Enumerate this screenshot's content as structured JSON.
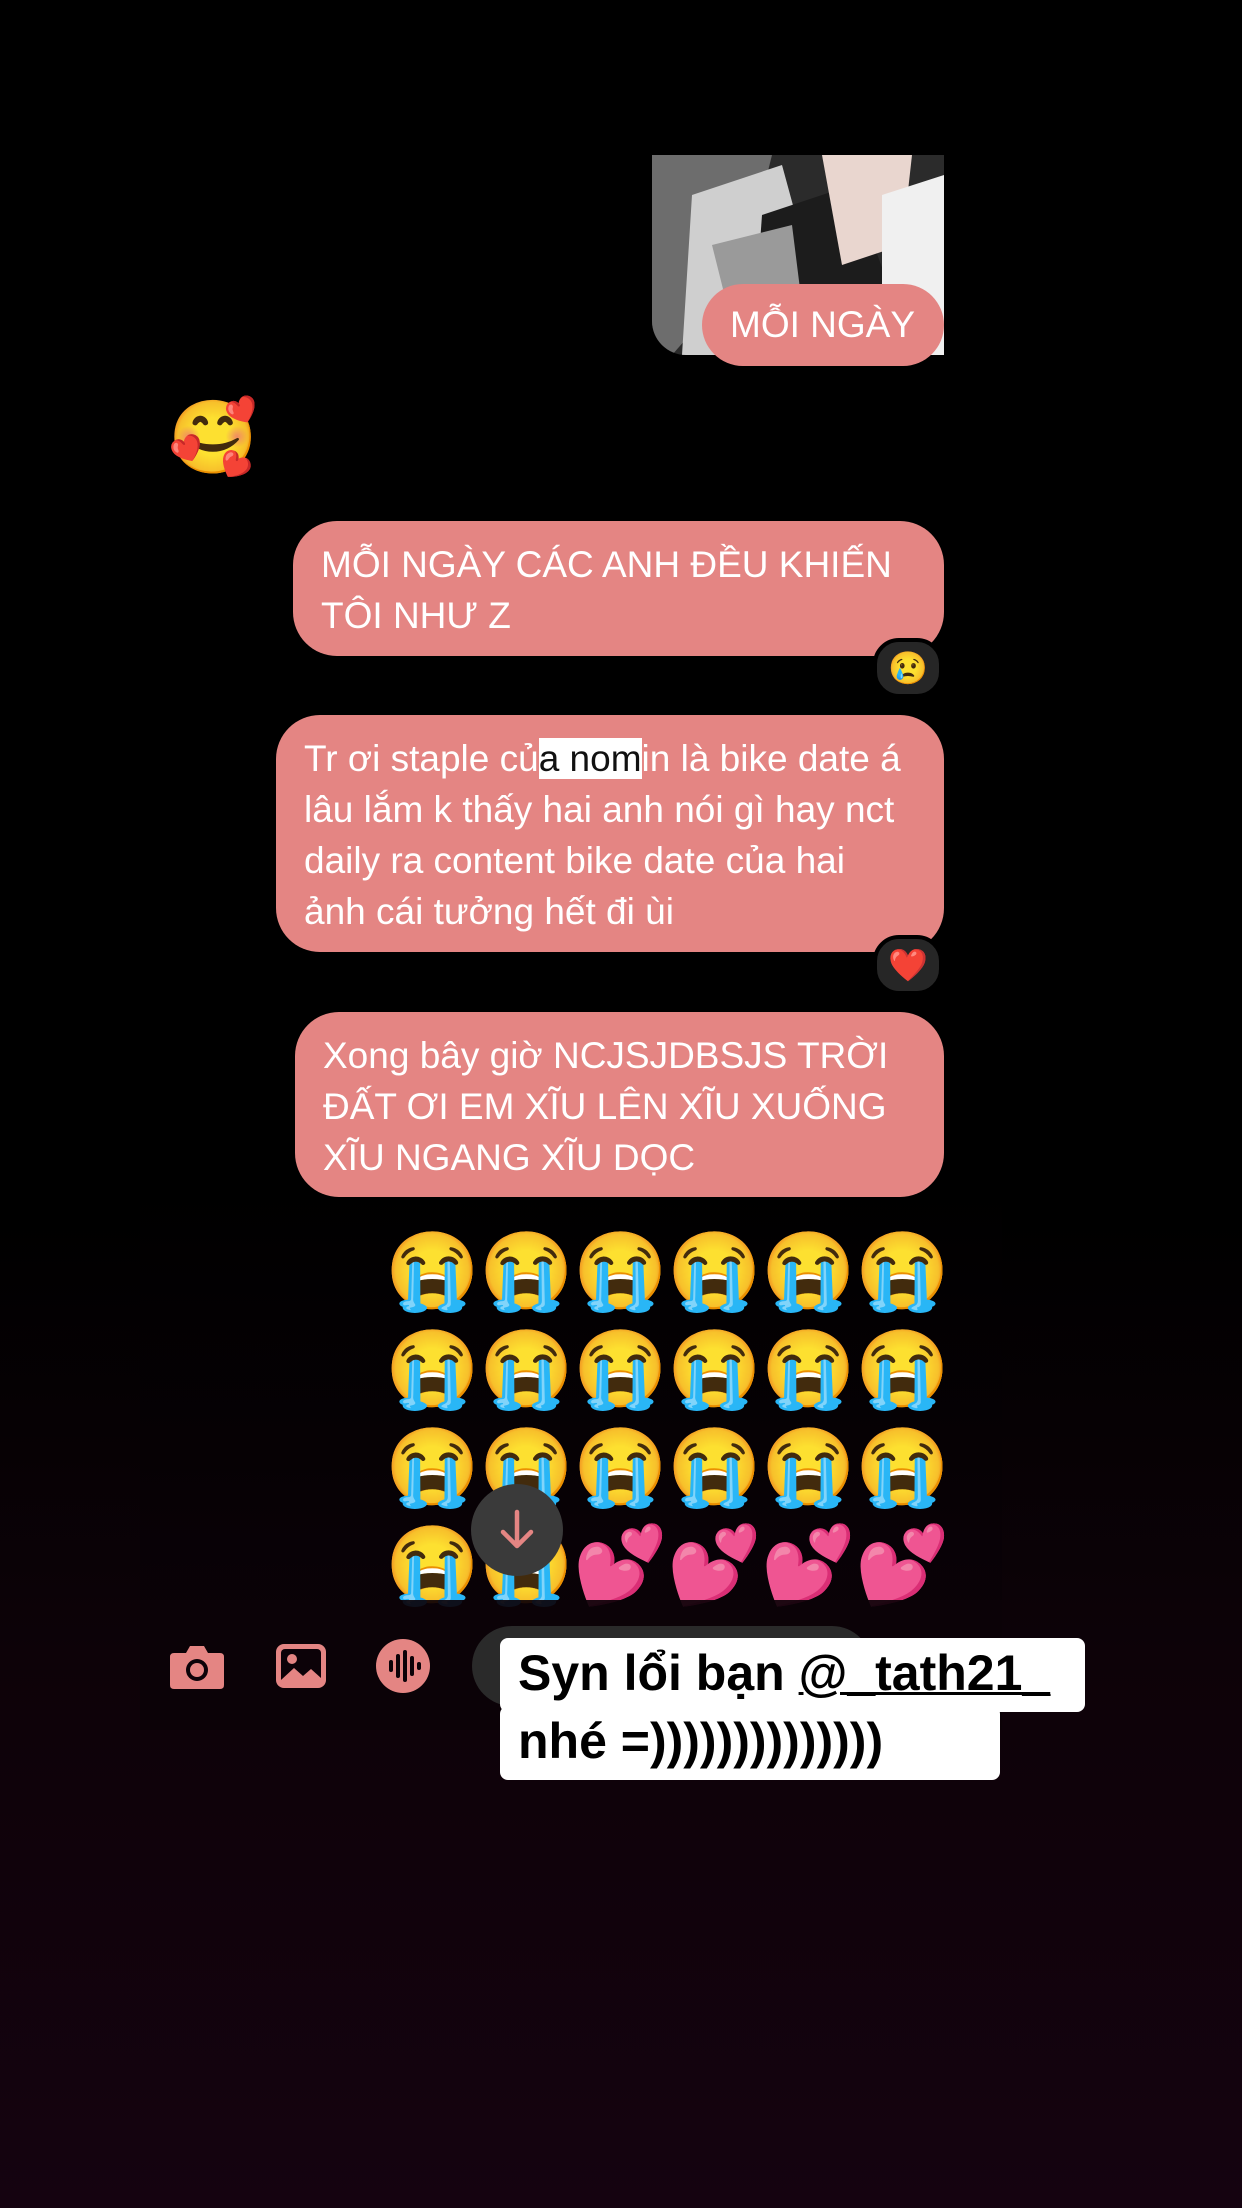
{
  "messages": [
    {
      "id": "m1",
      "text": "MỖI NGÀY",
      "has_image_thumbnail": true
    },
    {
      "id": "m_emoji",
      "text": "🥰"
    },
    {
      "id": "m2",
      "text": "MỖI NGÀY CÁC ANH ĐỀU KHIẾN TÔI NHƯ Z",
      "reaction": "😢"
    },
    {
      "id": "m3",
      "text_before": "Tr ơi staple củ",
      "text_highlight": "a nom",
      "text_after": "in là bike date á lâu lắm k thấy hai anh nói gì hay nct daily ra content bike date của hai ảnh cái tưởng hết đi ùi",
      "reaction": "❤️"
    },
    {
      "id": "m4",
      "text": "Xong bây giờ NCJSJDBSJS TRỜI ĐẤT ƠI EM XĨU LÊN XĨU XUỐNG XĨU NGANG XĨU DỌC"
    }
  ],
  "emoji_grid": [
    "😭",
    "😭",
    "😭",
    "😭",
    "😭",
    "😭",
    "😭",
    "😭",
    "😭",
    "😭",
    "😭",
    "😭",
    "😭",
    "😭",
    "😭",
    "😭",
    "😭",
    "😭",
    "😭",
    "😭",
    "💕",
    "💕",
    "💕",
    "💕"
  ],
  "composer": {
    "icons": [
      "camera-icon",
      "image-icon",
      "voice-icon"
    ]
  },
  "caption": {
    "line1_prefix": "Syn lổi bạn ",
    "mention": "@_tath21_",
    "line2": "nhé =))))))))))))))"
  },
  "colors": {
    "bubble": "#e48583",
    "background": "#000000",
    "icon": "#e48583"
  }
}
